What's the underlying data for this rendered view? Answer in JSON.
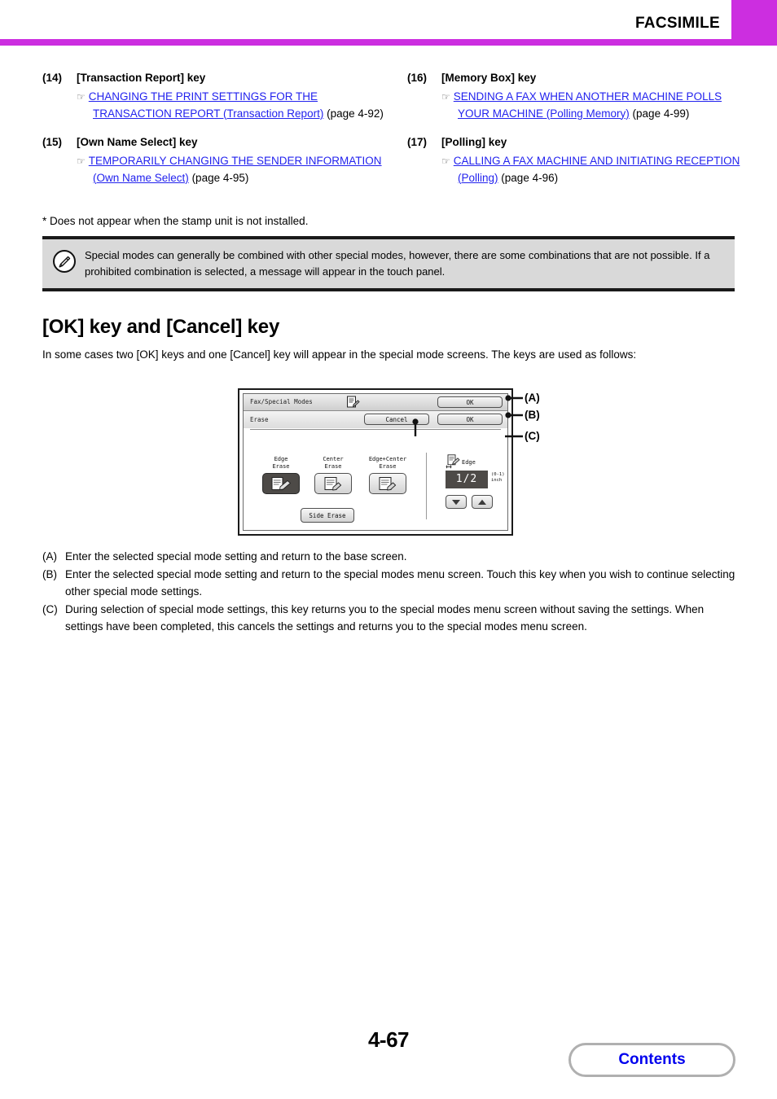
{
  "header": {
    "title": "FACSIMILE",
    "accent_color": "#cc2ee0"
  },
  "key_list": {
    "left_column": [
      {
        "number": "(14)",
        "label": "[Transaction Report] key",
        "icon": "pointing-hand-icon",
        "link_text": "CHANGING THE PRINT SETTINGS FOR THE TRANSACTION REPORT (Transaction Report)",
        "page_ref": "(page 4-92)"
      },
      {
        "number": "(15)",
        "label": "[Own Name Select] key",
        "icon": "pointing-hand-icon",
        "link_text": "TEMPORARILY CHANGING THE SENDER INFORMATION (Own Name Select)",
        "page_ref": "(page 4-95)"
      }
    ],
    "right_column": [
      {
        "number": "(16)",
        "label": "[Memory Box] key",
        "icon": "pointing-hand-icon",
        "link_text": "SENDING A FAX WHEN ANOTHER MACHINE POLLS YOUR MACHINE (Polling Memory)",
        "page_ref": "(page 4-99)"
      },
      {
        "number": "(17)",
        "label": "[Polling] key",
        "icon": "pointing-hand-icon",
        "link_text": "CALLING A FAX MACHINE AND INITIATING RECEPTION (Polling)",
        "page_ref": "(page 4-96)"
      }
    ]
  },
  "footnote": "* Does not appear when the stamp unit is not installed.",
  "note_box": {
    "icon": "pencil-note-icon",
    "text": "Special modes can generally be combined with other special modes, however, there are some combinations that are not possible. If a prohibited combination is selected, a message will appear in the touch panel."
  },
  "section": {
    "heading": "[OK] key and [Cancel] key",
    "intro": "In some cases two [OK] keys and one [Cancel] key will appear in the special mode screens. The keys are used as follows:"
  },
  "touch_panel": {
    "title": "Fax/Special Modes",
    "subtitle": "Erase",
    "ok_top_label": "OK",
    "ok_bottom_label": "OK",
    "cancel_label": "Cancel",
    "modes": [
      {
        "label": "Edge\nErase",
        "selected": true
      },
      {
        "label": "Center\nErase",
        "selected": false
      },
      {
        "label": "Edge+Center\nErase",
        "selected": false
      }
    ],
    "side_erase_label": "Side Erase",
    "edge_label": "Edge",
    "value": "1/2",
    "range_note": "(0-1)\ninch",
    "down_arrow": "▼",
    "up_arrow": "▲",
    "selected_bg": "#4d4a47"
  },
  "callouts": {
    "a": "(A)",
    "b": "(B)",
    "c": "(C)"
  },
  "explanations": [
    {
      "tag": "(A)",
      "text": "Enter the selected special mode setting and return to the base screen."
    },
    {
      "tag": "(B)",
      "text": "Enter the selected special mode setting and return to the special modes menu screen. Touch this key when you wish to continue selecting other special mode settings."
    },
    {
      "tag": "(C)",
      "text": "During selection of special mode settings, this key returns you to the special modes menu screen without saving the settings. When settings have been completed, this cancels the settings and returns you to the special modes menu screen."
    }
  ],
  "footer": {
    "page_number": "4-67",
    "contents_label": "Contents",
    "contents_color": "#0000ee"
  }
}
